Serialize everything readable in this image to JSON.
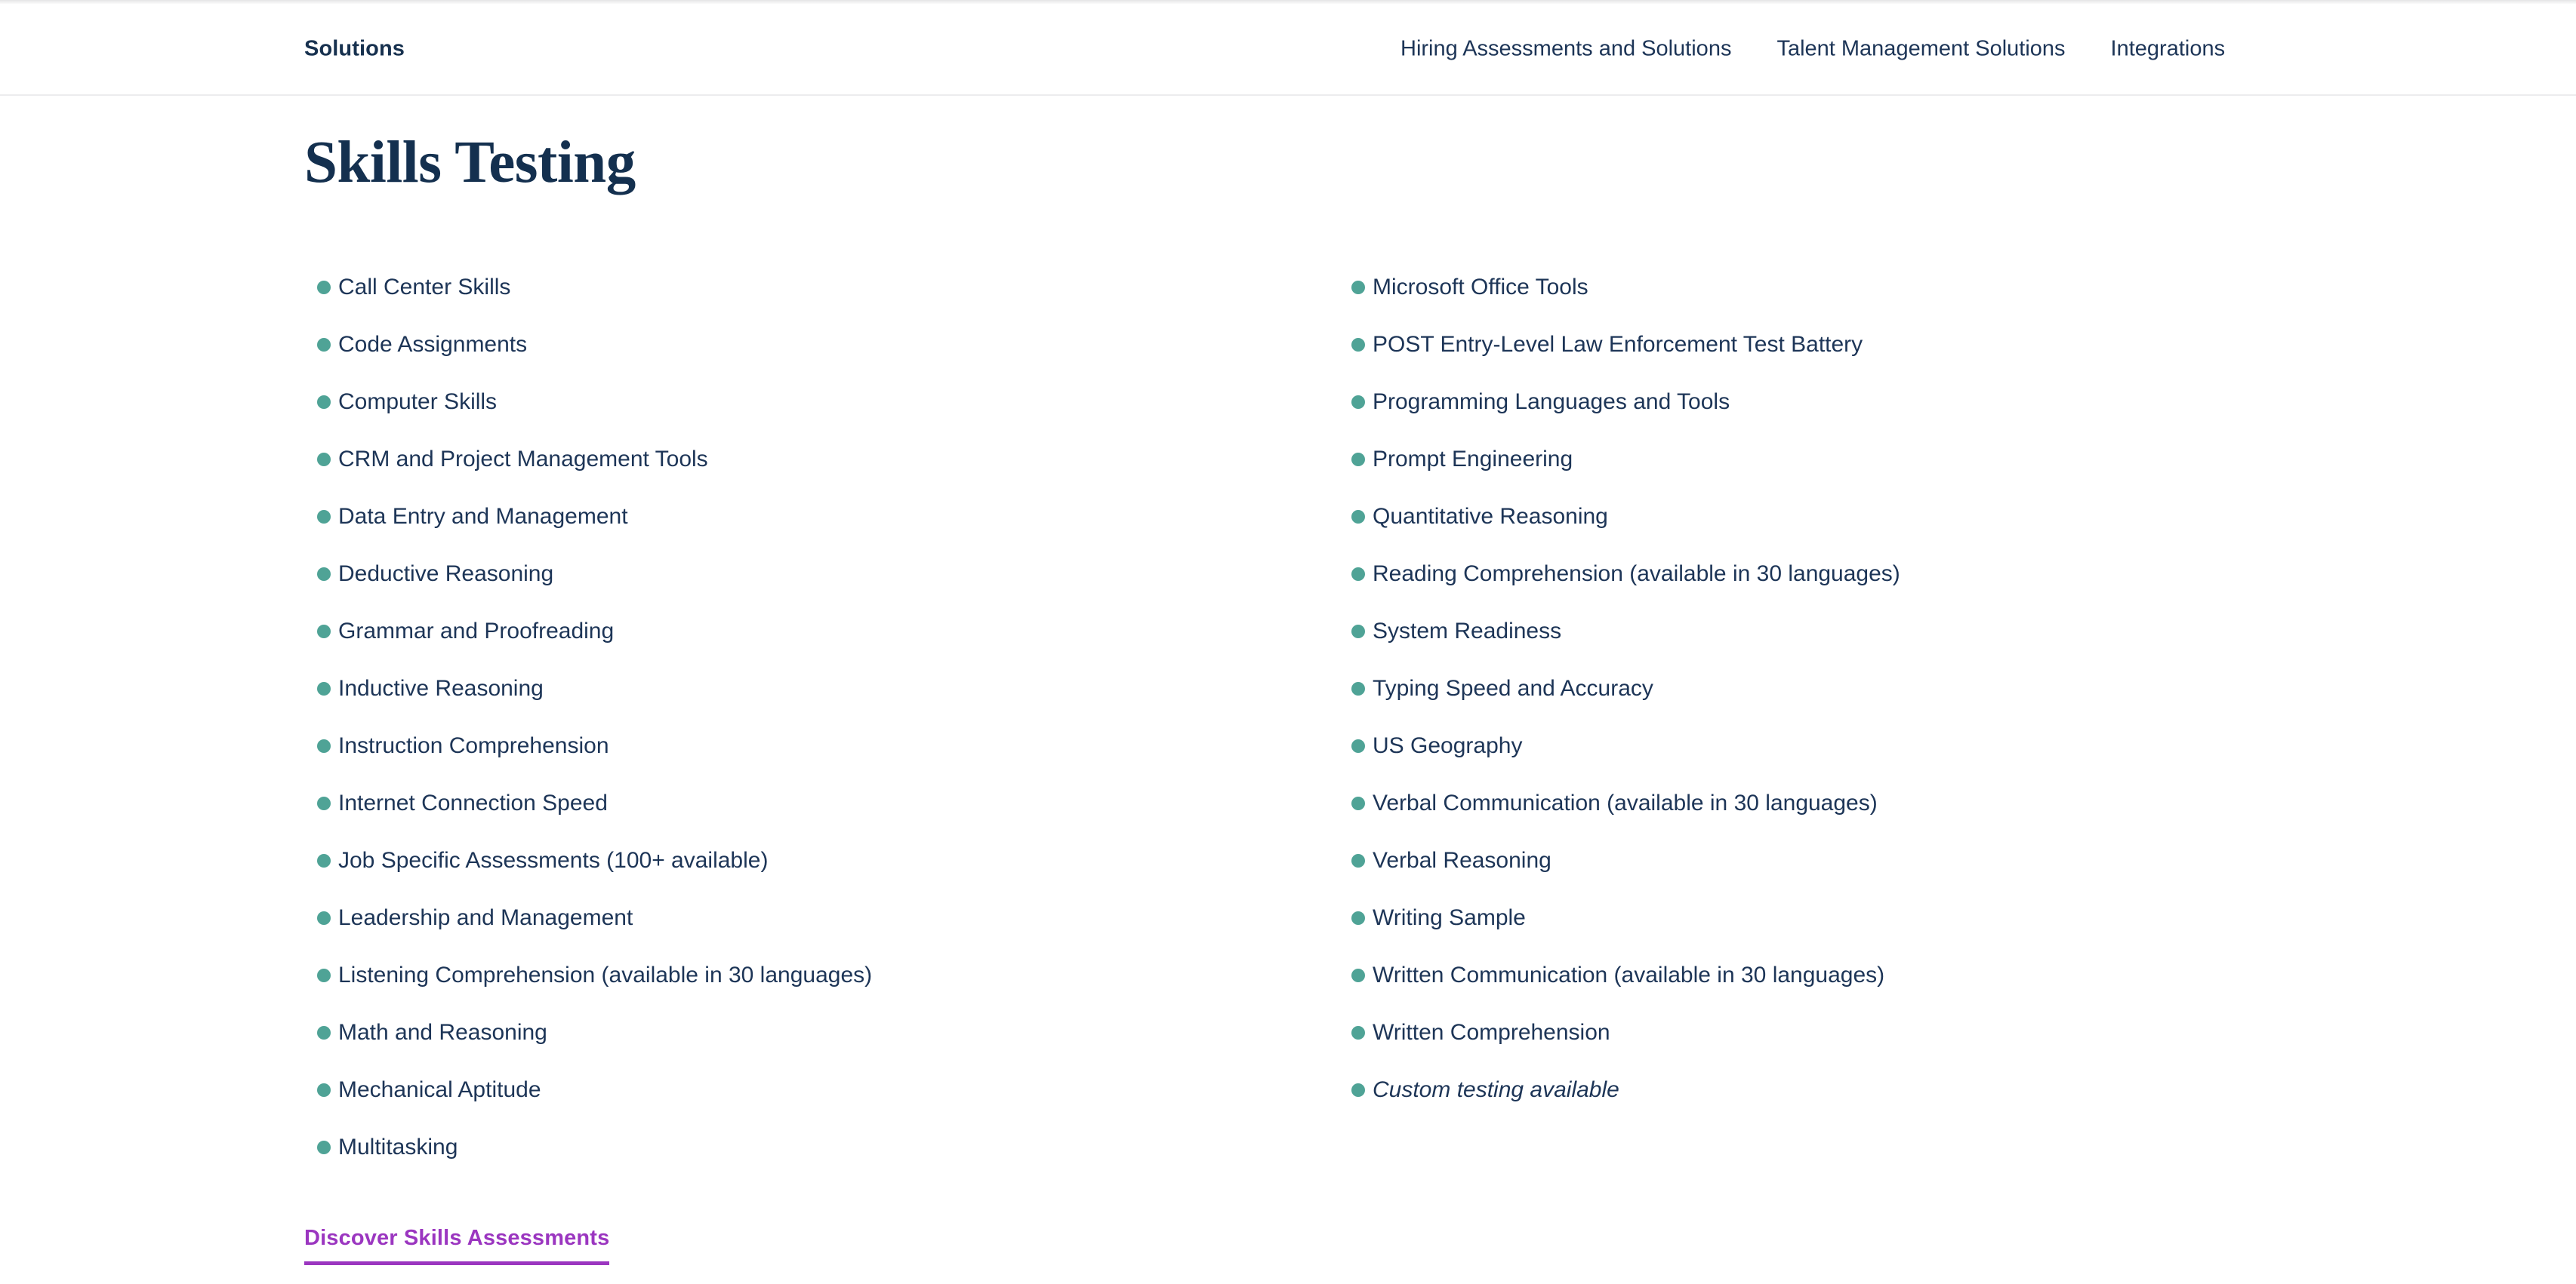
{
  "header": {
    "brand": "Solutions",
    "nav": [
      {
        "label": "Hiring Assessments and Solutions"
      },
      {
        "label": "Talent Management Solutions"
      },
      {
        "label": "Integrations"
      }
    ]
  },
  "main": {
    "title": "Skills Testing",
    "bullet_color": "#4fa396",
    "text_color": "#1d3557",
    "columns": {
      "left": [
        {
          "label": "Call Center Skills",
          "italic": false
        },
        {
          "label": "Code Assignments",
          "italic": false
        },
        {
          "label": "Computer Skills",
          "italic": false
        },
        {
          "label": "CRM and Project Management Tools",
          "italic": false
        },
        {
          "label": "Data Entry and Management",
          "italic": false
        },
        {
          "label": "Deductive Reasoning",
          "italic": false
        },
        {
          "label": "Grammar and Proofreading",
          "italic": false
        },
        {
          "label": "Inductive Reasoning",
          "italic": false
        },
        {
          "label": "Instruction Comprehension",
          "italic": false
        },
        {
          "label": "Internet Connection Speed",
          "italic": false
        },
        {
          "label": "Job Specific Assessments (100+ available)",
          "italic": false
        },
        {
          "label": "Leadership and Management",
          "italic": false
        },
        {
          "label": "Listening Comprehension (available in 30 languages)",
          "italic": false
        },
        {
          "label": "Math and Reasoning",
          "italic": false
        },
        {
          "label": "Mechanical Aptitude",
          "italic": false
        },
        {
          "label": "Multitasking",
          "italic": false
        }
      ],
      "right": [
        {
          "label": "Microsoft Office Tools",
          "italic": false
        },
        {
          "label": "POST Entry-Level Law Enforcement Test Battery",
          "italic": false
        },
        {
          "label": "Programming Languages and Tools",
          "italic": false
        },
        {
          "label": "Prompt Engineering",
          "italic": false
        },
        {
          "label": "Quantitative Reasoning",
          "italic": false
        },
        {
          "label": "Reading Comprehension (available in 30 languages)",
          "italic": false
        },
        {
          "label": "System Readiness",
          "italic": false
        },
        {
          "label": "Typing Speed and Accuracy",
          "italic": false
        },
        {
          "label": "US Geography",
          "italic": false
        },
        {
          "label": "Verbal Communication (available in 30 languages)",
          "italic": false
        },
        {
          "label": "Verbal Reasoning",
          "italic": false
        },
        {
          "label": "Writing Sample",
          "italic": false
        },
        {
          "label": "Written Communication (available in 30 languages)",
          "italic": false
        },
        {
          "label": "Written Comprehension",
          "italic": false
        },
        {
          "label": "Custom testing available",
          "italic": true
        }
      ]
    }
  },
  "cta": {
    "label": "Discover Skills Assessments",
    "color": "#9b36c0"
  }
}
